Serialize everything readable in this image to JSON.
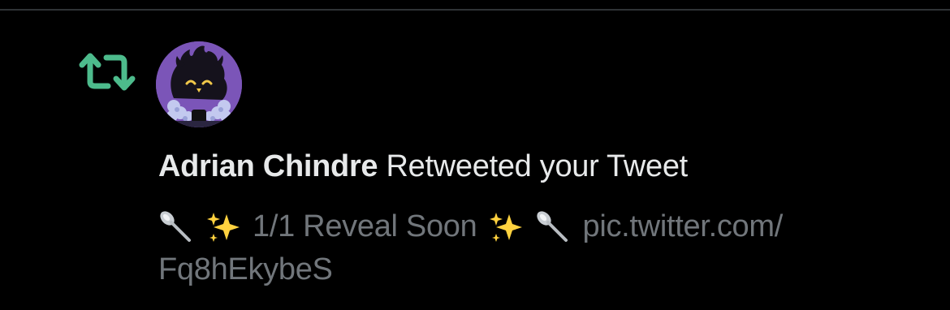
{
  "notification": {
    "type_icon": "retweet-icon",
    "avatar_icon": "cat-avatar-icon",
    "user_name": "Adrian Chindre",
    "action_text": "Retweeted your Tweet",
    "tweet": {
      "text_main": "1/1 Reveal Soon",
      "link_line1": "pic.twitter.com/",
      "link_line2": "Fq8hEkybeS",
      "emoji_icons": [
        "spoon-icon",
        "sparkles-icon",
        "sparkles-icon",
        "spoon-icon"
      ]
    }
  },
  "colors": {
    "background": "#000000",
    "retweet_green": "#4dbb8c",
    "primary_text": "#e7e9ea",
    "secondary_text": "#71767b",
    "divider": "#2f3336",
    "avatar_purple": "#7b55b8"
  }
}
